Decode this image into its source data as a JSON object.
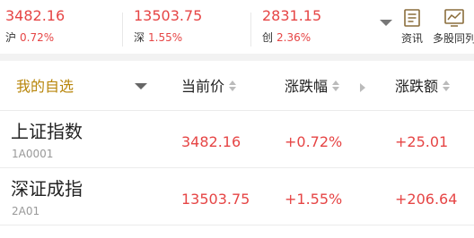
{
  "indices": [
    {
      "value": "3482.16",
      "name": "沪",
      "pct": "0.72%"
    },
    {
      "value": "13503.75",
      "name": "深",
      "pct": "1.55%"
    },
    {
      "value": "2831.15",
      "name": "创",
      "pct": "2.36%"
    }
  ],
  "toolbar": {
    "news_label": "资讯",
    "multi_label": "多股同列",
    "news_icon": "news-icon",
    "multi_icon": "chart-grid-icon"
  },
  "table": {
    "headers": {
      "mine": "我的自选",
      "price": "当前价",
      "pct": "涨跌幅",
      "amount": "涨跌额"
    },
    "rows": [
      {
        "name": "上证指数",
        "code": "1A0001",
        "price": "3482.16",
        "pct": "+0.72%",
        "amount": "+25.01"
      },
      {
        "name": "深证成指",
        "code": "2A01",
        "price": "13503.75",
        "pct": "+1.55%",
        "amount": "+206.64"
      }
    ]
  },
  "colors": {
    "up": "#e64545",
    "accent": "#b8860b"
  }
}
